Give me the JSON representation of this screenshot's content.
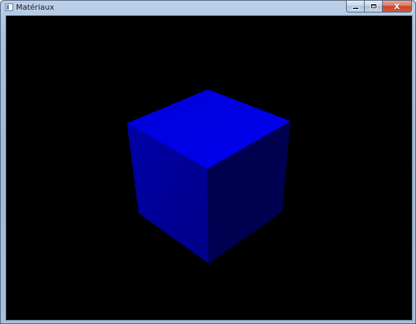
{
  "window": {
    "title": "Matériaux",
    "controls": {
      "minimize_icon": "minimize-icon",
      "maximize_icon": "maximize-icon",
      "close_icon": "close-icon",
      "close_glyph": "X"
    }
  },
  "scene": {
    "background_color": "#000000",
    "object": "cube",
    "face_colors": {
      "top": "#0000e0",
      "left": "#000098",
      "right": "#000050"
    }
  }
}
